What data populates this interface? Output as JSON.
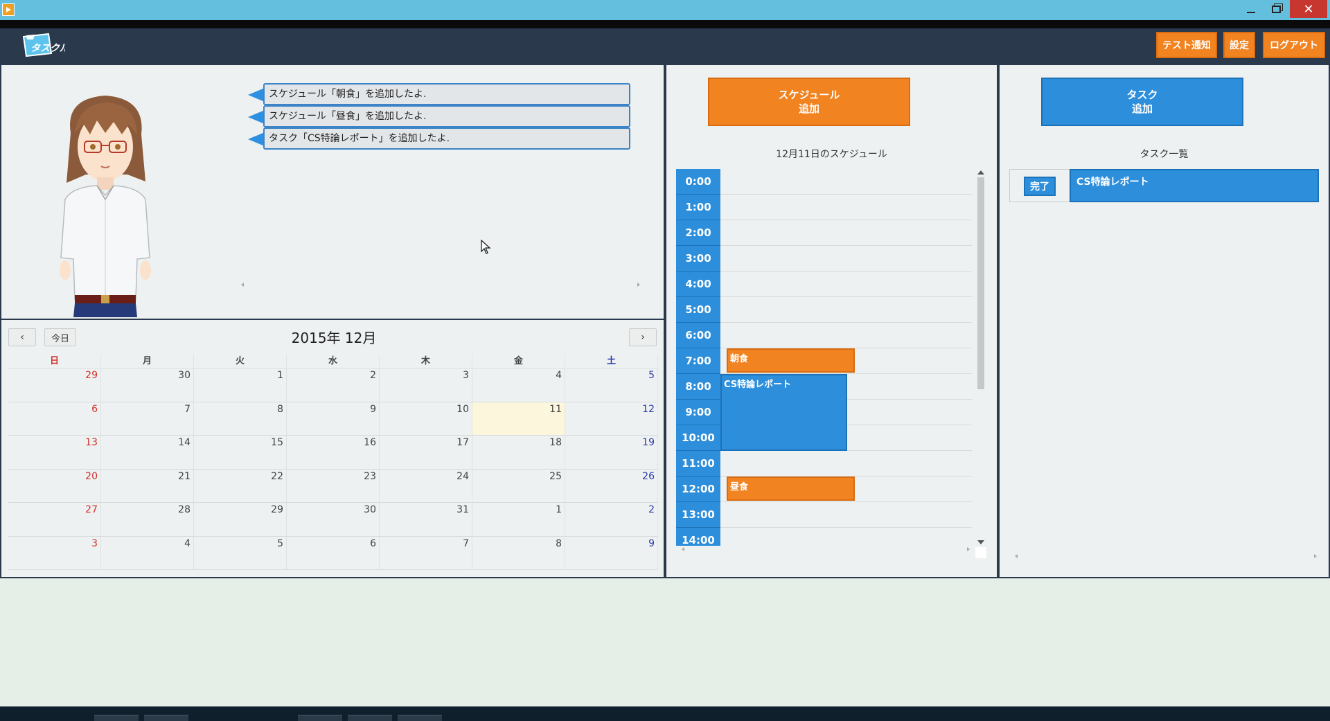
{
  "window": {
    "controls": [
      "minimize-icon",
      "maximize-icon",
      "close-icon"
    ],
    "close_glyph": "✕",
    "accent": "#64bede"
  },
  "header": {
    "logo_text": "タスクル",
    "buttons": {
      "test_notify": "テスト通知",
      "settings": "設定",
      "logout": "ログアウト"
    }
  },
  "messages": [
    "スケジュール「朝食」を追加したよ.",
    "スケジュール「昼食」を追加したよ.",
    "タスク「CS特論レポート」を追加したよ."
  ],
  "calendar": {
    "prev_glyph": "‹",
    "next_glyph": "›",
    "today_label": "今日",
    "title": "2015年 12月",
    "weekdays": [
      "日",
      "月",
      "火",
      "水",
      "木",
      "金",
      "土"
    ],
    "weeks": [
      [
        "29",
        "30",
        "1",
        "2",
        "3",
        "4",
        "5"
      ],
      [
        "6",
        "7",
        "8",
        "9",
        "10",
        "11",
        "12"
      ],
      [
        "13",
        "14",
        "15",
        "16",
        "17",
        "18",
        "19"
      ],
      [
        "20",
        "21",
        "22",
        "23",
        "24",
        "25",
        "26"
      ],
      [
        "27",
        "28",
        "29",
        "30",
        "31",
        "1",
        "2"
      ],
      [
        "3",
        "4",
        "5",
        "6",
        "7",
        "8",
        "9"
      ]
    ],
    "today": "11"
  },
  "schedule": {
    "add_button": {
      "line1": "スケジュール",
      "line2": "追加"
    },
    "title": "12月11日のスケジュール",
    "hours": [
      "0:00",
      "1:00",
      "2:00",
      "3:00",
      "4:00",
      "5:00",
      "6:00",
      "7:00",
      "8:00",
      "9:00",
      "10:00",
      "11:00",
      "12:00",
      "13:00",
      "14:00"
    ],
    "events": [
      {
        "name": "朝食",
        "start": 7,
        "end": 8,
        "color": "orange"
      },
      {
        "name": "CS特論レポート",
        "start": 8,
        "end": 11,
        "color": "blue"
      },
      {
        "name": "昼食",
        "start": 12,
        "end": 13,
        "color": "orange"
      }
    ]
  },
  "tasks": {
    "add_button": {
      "line1": "タスク",
      "line2": "追加"
    },
    "title": "タスク一覧",
    "items": [
      {
        "done_label": "完了",
        "name": "CS特論レポート"
      }
    ]
  },
  "colors": {
    "orange": "#f18321",
    "blue": "#2d8fdb",
    "header": "#2a3a4c"
  }
}
